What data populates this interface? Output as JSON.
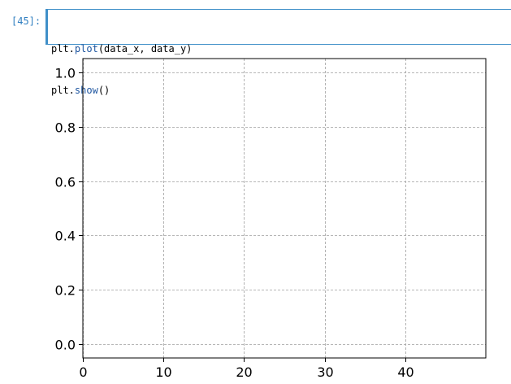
{
  "cell": {
    "prompt": "[45]:",
    "code_lines": [
      {
        "obj": "plt.",
        "fn": "plot",
        "rest": "(data_x, data_y)"
      },
      {
        "obj": "plt.",
        "fn": "show",
        "rest": "()"
      }
    ]
  },
  "colors": {
    "prompt": "#307fc1",
    "cell_border": "#3f8fc8",
    "function": "#1f56a0",
    "grid": "#a0a0a0"
  },
  "chart_data": {
    "type": "line",
    "title": "",
    "xlabel": "",
    "ylabel": "",
    "xlim": [
      0,
      50
    ],
    "ylim": [
      -0.05,
      1.05
    ],
    "xticks": [
      0,
      10,
      20,
      30,
      40
    ],
    "xtick_labels": [
      "0",
      "10",
      "20",
      "30",
      "40"
    ],
    "yticks": [
      0.0,
      0.2,
      0.4,
      0.6,
      0.8,
      1.0
    ],
    "ytick_labels": [
      "0.0",
      "0.2",
      "0.4",
      "0.6",
      "0.8",
      "1.0"
    ],
    "grid": true,
    "series": []
  }
}
